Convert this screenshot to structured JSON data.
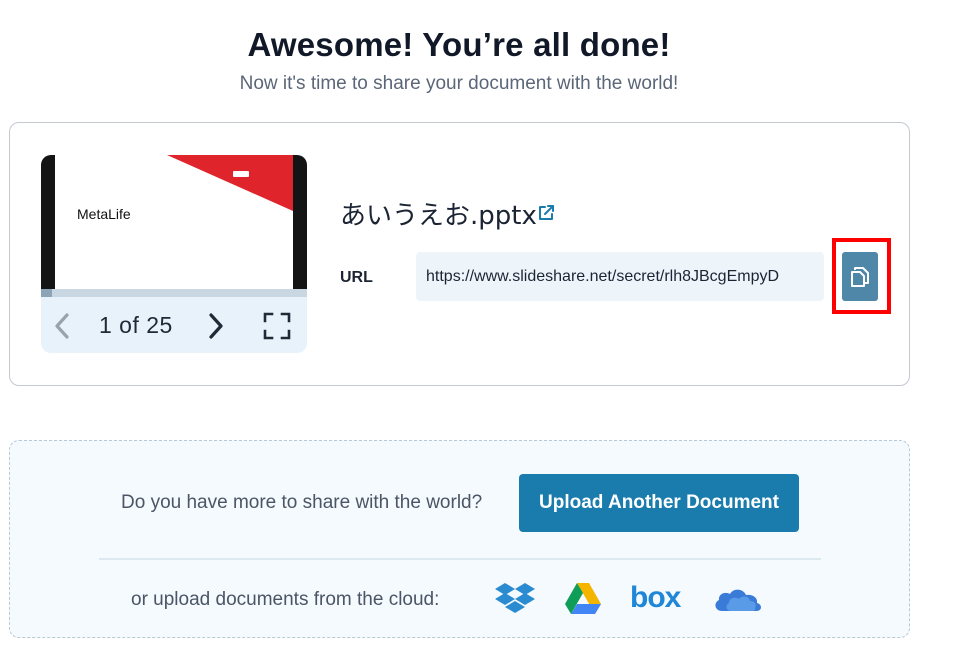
{
  "header": {
    "title": "Awesome! You’re all done!",
    "subtitle": "Now it's time to share your document with the world!"
  },
  "preview": {
    "slide_brand": "MetaLife",
    "page_current": 1,
    "page_total": 25,
    "page_label": "1 of 25",
    "progress_fraction": 0.04,
    "icons": {
      "prev": "chevron-left-icon",
      "next": "chevron-right-icon",
      "fullscreen": "fullscreen-icon"
    }
  },
  "document": {
    "filename": "あいうえお.pptx",
    "external_link_icon": "external-link-icon",
    "url_label": "URL",
    "url_value": "https://www.slideshare.net/secret/rlh8JBcgEmpyD",
    "copy_icon": "copy-icon"
  },
  "upload": {
    "prompt": "Do you have more to share with the world?",
    "button_label": "Upload Another Document",
    "cloud_prompt": "or upload documents from the cloud:",
    "providers": [
      "dropbox-icon",
      "google-drive-icon",
      "box-icon",
      "onedrive-icon"
    ],
    "box_wordmark": "box"
  },
  "colors": {
    "accent": "#1a7cad",
    "copy_button": "#4f87a8",
    "highlight": "#ff0000",
    "slide_red": "#e0242c"
  }
}
